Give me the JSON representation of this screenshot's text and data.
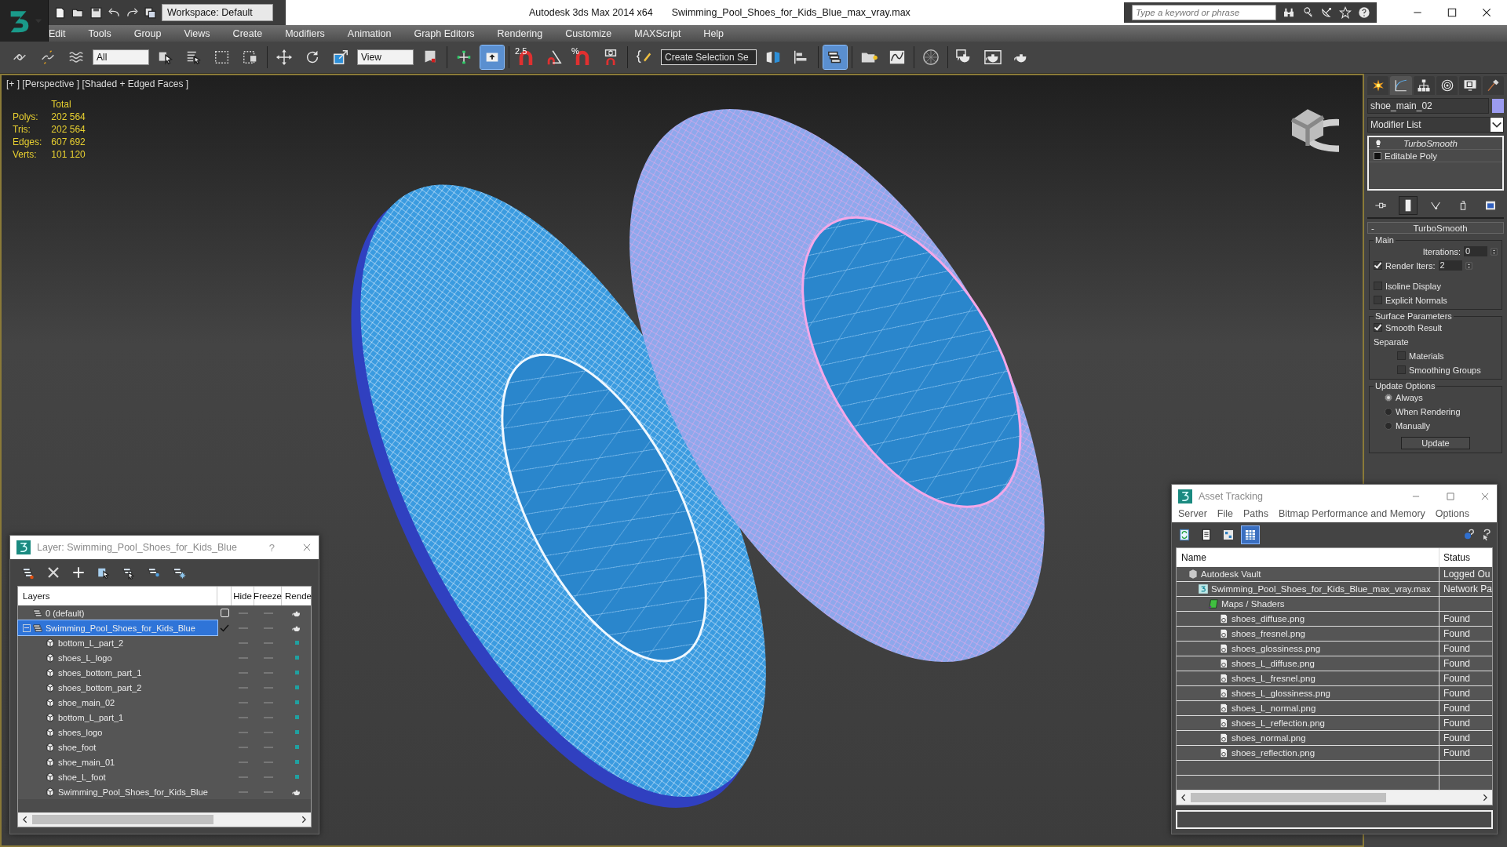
{
  "window": {
    "app_title": "Autodesk 3ds Max  2014 x64",
    "file_title": "Swimming_Pool_Shoes_for_Kids_Blue_max_vray.max",
    "workspace": "Workspace: Default",
    "search": {
      "placeholder": "Type a keyword or phrase"
    }
  },
  "menu": [
    "Edit",
    "Tools",
    "Group",
    "Views",
    "Create",
    "Modifiers",
    "Animation",
    "Graph Editors",
    "Rendering",
    "Customize",
    "MAXScript",
    "Help"
  ],
  "toolbar": [
    {
      "kind": "link",
      "selected": false
    },
    {
      "kind": "unlink",
      "selected": false
    },
    {
      "kind": "bind",
      "selected": false
    },
    {
      "kind": "dropdown",
      "value": "All"
    },
    {
      "kind": "select",
      "selected": false
    },
    {
      "kind": "select-name",
      "selected": false
    },
    {
      "kind": "region",
      "selected": false
    },
    {
      "kind": "crossing",
      "selected": false
    },
    {
      "kind": "sep"
    },
    {
      "kind": "move",
      "selected": false
    },
    {
      "kind": "rotate",
      "selected": false
    },
    {
      "kind": "scale",
      "selected": false
    },
    {
      "kind": "dropdown",
      "value": "View"
    },
    {
      "kind": "pivot",
      "selected": false
    },
    {
      "kind": "sep"
    },
    {
      "kind": "manipulate",
      "selected": false
    },
    {
      "kind": "keyboard",
      "selected": true
    },
    {
      "kind": "sep"
    },
    {
      "kind": "snap",
      "label": "2.5",
      "selected": false
    },
    {
      "kind": "angle-snap",
      "selected": false
    },
    {
      "kind": "percent-snap",
      "label": "%",
      "selected": false
    },
    {
      "kind": "spinner-snap",
      "selected": false
    },
    {
      "kind": "sep"
    },
    {
      "kind": "named-sets",
      "selected": false
    },
    {
      "kind": "combo",
      "value": "Create Selection Se"
    },
    {
      "kind": "mirror",
      "selected": false
    },
    {
      "kind": "align",
      "selected": false
    },
    {
      "kind": "sep"
    },
    {
      "kind": "layers",
      "selected": true
    },
    {
      "kind": "sep"
    },
    {
      "kind": "scene",
      "selected": false
    },
    {
      "kind": "curve",
      "selected": false
    },
    {
      "kind": "sep"
    },
    {
      "kind": "material",
      "selected": false
    },
    {
      "kind": "sep"
    },
    {
      "kind": "render-setup",
      "selected": false
    },
    {
      "kind": "render-frame",
      "selected": false
    },
    {
      "kind": "render",
      "selected": false
    }
  ],
  "viewport": {
    "label": "[+ ] [Perspective ] [Shaded + Edged Faces ]",
    "stats_header": "Total",
    "stats": [
      {
        "label": "Polys:",
        "value": "202 564"
      },
      {
        "label": "Tris:",
        "value": "202 564"
      },
      {
        "label": "Edges:",
        "value": "607 692"
      },
      {
        "label": "Verts:",
        "value": "101 120"
      }
    ]
  },
  "command_panel": {
    "tabs": [
      {
        "kind": "create",
        "selected": false
      },
      {
        "kind": "modify",
        "selected": true
      },
      {
        "kind": "hierarchy",
        "selected": false
      },
      {
        "kind": "motion",
        "selected": false
      },
      {
        "kind": "display",
        "selected": false
      },
      {
        "kind": "utilities",
        "selected": false
      }
    ],
    "object_name": "shoe_main_02",
    "modifier_list": "Modifier List",
    "stack": [
      {
        "name": "TurboSmooth",
        "kind": "modifier"
      },
      {
        "name": "Editable Poly",
        "kind": "base"
      }
    ],
    "stack_tools": [
      {
        "kind": "pin",
        "selected": false
      },
      {
        "kind": "end-result",
        "selected": true
      },
      {
        "kind": "unique",
        "selected": false
      },
      {
        "kind": "remove",
        "selected": false
      },
      {
        "kind": "configure",
        "selected": false
      }
    ],
    "rollout": {
      "collapse": "-",
      "title": "TurboSmooth",
      "main": {
        "title": "Main",
        "iterations_label": "Iterations:",
        "iterations": "0",
        "render_iters": {
          "label": "Render Iters:",
          "checked": true,
          "value": "2"
        },
        "isoline": {
          "label": "Isoline Display",
          "checked": false
        },
        "explicit": {
          "label": "Explicit Normals",
          "checked": false
        }
      },
      "surface": {
        "title": "Surface Parameters",
        "smooth": {
          "label": "Smooth Result",
          "checked": true
        },
        "separate": "Separate",
        "materials": {
          "label": "Materials",
          "checked": false
        },
        "smoothing": {
          "label": "Smoothing Groups",
          "checked": false
        }
      },
      "update": {
        "title": "Update Options",
        "options": [
          {
            "label": "Always",
            "selected": true
          },
          {
            "label": "When Rendering",
            "selected": false
          },
          {
            "label": "Manually",
            "selected": false
          }
        ],
        "button": "Update"
      }
    }
  },
  "layer_dialog": {
    "title": "Layer: Swimming_Pool_Shoes_for_Kids_Blue",
    "help": "?",
    "columns": [
      "Layers",
      "Hide",
      "Freeze",
      "Rende"
    ],
    "layers": [
      {
        "name": "0 (default)",
        "current": false,
        "selected": false,
        "hidden": false,
        "frozen": false
      },
      {
        "name": "Swimming_Pool_Shoes_for_Kids_Blue",
        "current": true,
        "selected": true,
        "expanded": true,
        "hidden": false,
        "frozen": false,
        "children": [
          {
            "name": "bottom_L_part_2",
            "kind": "object",
            "hidden": false,
            "frozen": false
          },
          {
            "name": "shoes_L_logo",
            "kind": "object",
            "hidden": false,
            "frozen": false
          },
          {
            "name": "shoes_bottom_part_1",
            "kind": "object",
            "hidden": false,
            "frozen": false
          },
          {
            "name": "shoes_bottom_part_2",
            "kind": "object",
            "hidden": false,
            "frozen": false
          },
          {
            "name": "shoe_main_02",
            "kind": "object",
            "hidden": false,
            "frozen": false
          },
          {
            "name": "bottom_L_part_1",
            "kind": "object",
            "hidden": false,
            "frozen": false
          },
          {
            "name": "shoes_logo",
            "kind": "object",
            "hidden": false,
            "frozen": false
          },
          {
            "name": "shoe_foot",
            "kind": "object",
            "hidden": false,
            "frozen": false
          },
          {
            "name": "shoe_main_01",
            "kind": "object",
            "hidden": false,
            "frozen": false
          },
          {
            "name": "shoe_L_foot",
            "kind": "object",
            "hidden": false,
            "frozen": false
          },
          {
            "name": "Swimming_Pool_Shoes_for_Kids_Blue",
            "kind": "group",
            "hidden": false,
            "frozen": false
          }
        ]
      }
    ]
  },
  "asset_tracking": {
    "title": "Asset Tracking",
    "menu": [
      "Server",
      "File",
      "Paths",
      "Bitmap Performance and Memory",
      "Options"
    ],
    "view_buttons": [
      {
        "kind": "refresh",
        "selected": false
      },
      {
        "kind": "list",
        "selected": false
      },
      {
        "kind": "thumbs",
        "selected": false
      },
      {
        "kind": "table",
        "selected": true
      }
    ],
    "columns": [
      "Name",
      "Status"
    ],
    "items": [
      {
        "name": "Autodesk Vault",
        "kind": "vault",
        "status": "Logged Ou",
        "children": [
          {
            "name": "Swimming_Pool_Shoes_for_Kids_Blue_max_vray.max",
            "kind": "max",
            "status": "Network Pa",
            "children": [
              {
                "name": "Maps / Shaders",
                "kind": "maps",
                "children": [
                  {
                    "name": "shoes_diffuse.png",
                    "kind": "bitmap",
                    "status": "Found"
                  },
                  {
                    "name": "shoes_fresnel.png",
                    "kind": "bitmap",
                    "status": "Found"
                  },
                  {
                    "name": "shoes_glossiness.png",
                    "kind": "bitmap",
                    "status": "Found"
                  },
                  {
                    "name": "shoes_L_diffuse.png",
                    "kind": "bitmap",
                    "status": "Found"
                  },
                  {
                    "name": "shoes_L_fresnel.png",
                    "kind": "bitmap",
                    "status": "Found"
                  },
                  {
                    "name": "shoes_L_glossiness.png",
                    "kind": "bitmap",
                    "status": "Found"
                  },
                  {
                    "name": "shoes_L_normal.png",
                    "kind": "bitmap",
                    "status": "Found"
                  },
                  {
                    "name": "shoes_L_reflection.png",
                    "kind": "bitmap",
                    "status": "Found"
                  },
                  {
                    "name": "shoes_normal.png",
                    "kind": "bitmap",
                    "status": "Found"
                  },
                  {
                    "name": "shoes_reflection.png",
                    "kind": "bitmap",
                    "status": "Found"
                  }
                ]
              }
            ]
          }
        ]
      }
    ]
  }
}
